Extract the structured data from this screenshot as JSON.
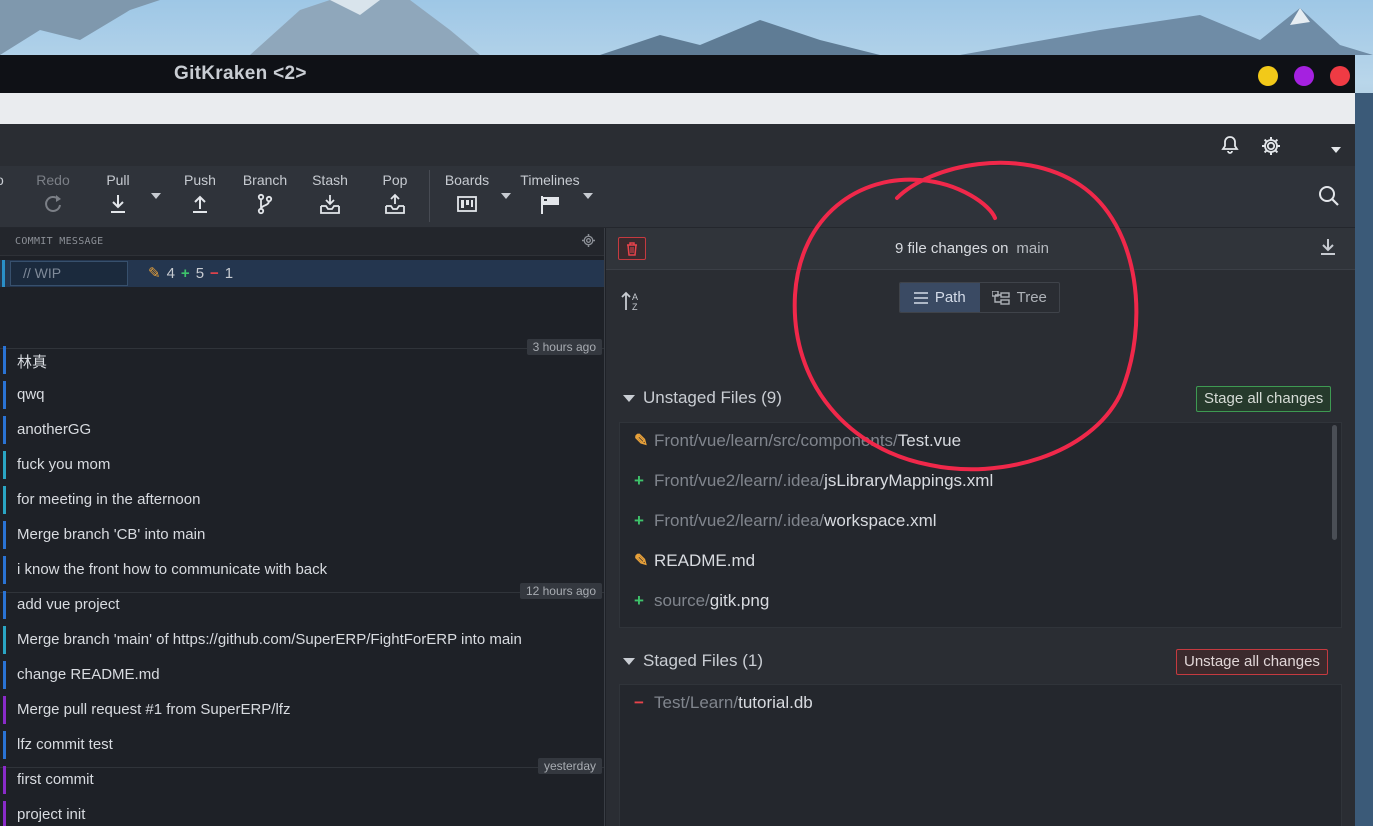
{
  "window": {
    "title": "GitKraken <2>"
  },
  "toolbar": {
    "undo_partial": "o",
    "redo": "Redo",
    "pull": "Pull",
    "push": "Push",
    "branch": "Branch",
    "stash": "Stash",
    "pop": "Pop",
    "boards": "Boards",
    "timelines": "Timelines"
  },
  "left": {
    "header": "COMMIT MESSAGE",
    "wip": {
      "placeholder": "// WIP",
      "modified": "4",
      "added": "5",
      "deleted": "1"
    },
    "commits": [
      {
        "msg": "林真",
        "color": "#2a73d4"
      },
      {
        "msg": "qwq",
        "color": "#2a73d4"
      },
      {
        "msg": "anotherGG",
        "color": "#2a73d4"
      },
      {
        "msg": "fuck you mom",
        "color": "#2aa5c3"
      },
      {
        "msg": "for meeting in the afternoon",
        "color": "#2aa5c3"
      },
      {
        "msg": "Merge branch 'CB' into main",
        "color": "#2a73d4"
      },
      {
        "msg": "i know the front how to communicate with back",
        "color": "#2a73d4"
      },
      {
        "msg": "add vue project",
        "color": "#2a73d4"
      },
      {
        "msg": "Merge branch 'main' of https://github.com/SuperERP/FightForERP into main",
        "color": "#2aa5c3"
      },
      {
        "msg": "change README.md",
        "color": "#2a73d4"
      },
      {
        "msg": "Merge pull request #1 from SuperERP/lfz",
        "color": "#8a2bc9"
      },
      {
        "msg": "lfz commit test",
        "color": "#2a73d4"
      },
      {
        "msg": "first commit",
        "color": "#8a2bc9"
      },
      {
        "msg": "project init",
        "color": "#8a2bc9"
      }
    ],
    "time_labels": {
      "t1": "3 hours ago",
      "t2": "12 hours ago",
      "t3": "yesterday"
    }
  },
  "right": {
    "changes_text": "9 file changes on",
    "branch": "main",
    "view_path": "Path",
    "view_tree": "Tree",
    "unstaged_title": "Unstaged Files (9)",
    "stage_all": "Stage all changes",
    "unstaged": [
      {
        "type": "mod",
        "path": "Front/vue/learn/src/components/",
        "name": "Test.vue"
      },
      {
        "type": "add",
        "path": "Front/vue2/learn/.idea/",
        "name": "jsLibraryMappings.xml"
      },
      {
        "type": "add",
        "path": "Front/vue2/learn/.idea/",
        "name": "workspace.xml"
      },
      {
        "type": "mod",
        "path": "",
        "name": "README.md"
      },
      {
        "type": "add",
        "path": "source/",
        "name": "gitk.png"
      }
    ],
    "staged_title": "Staged Files (1)",
    "unstage_all": "Unstage all changes",
    "staged": [
      {
        "type": "del",
        "path": "Test/Learn/",
        "name": "tutorial.db"
      }
    ]
  },
  "colors": {
    "annotation": "#f0284a",
    "accent": "#3a4a63"
  }
}
